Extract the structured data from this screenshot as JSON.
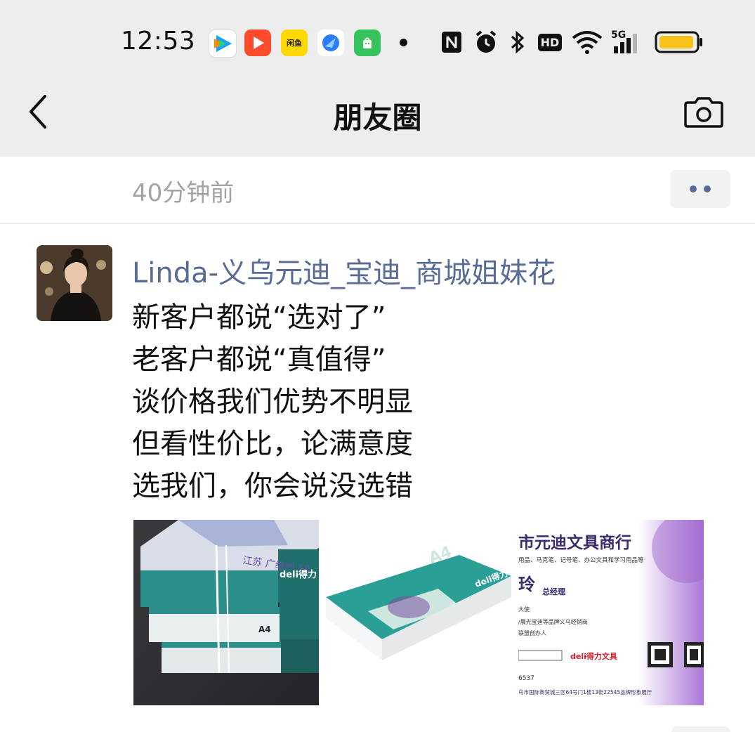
{
  "status_bar": {
    "time": "12:53",
    "app_icons": [
      {
        "name": "tencent-video-icon",
        "color": "#ffffff",
        "accent": "#1aa0ff"
      },
      {
        "name": "video-player-icon",
        "color": "#ff4b2b"
      },
      {
        "name": "xianyu-icon",
        "color": "#ffd900",
        "label": "闲鱼"
      },
      {
        "name": "browser-icon",
        "color": "#ffffff",
        "accent": "#2b7cff"
      },
      {
        "name": "shopping-icon",
        "color": "#37c35b"
      }
    ],
    "system_icons": [
      "nfc-icon",
      "alarm-icon",
      "bluetooth-icon",
      "hd-icon",
      "wifi-icon",
      "signal-5g-icon",
      "battery-icon"
    ],
    "hd_label": "HD",
    "network_label": "5G",
    "battery_color": "#f7c21b"
  },
  "nav": {
    "title": "朋友圈",
    "back_icon": "chevron-left-icon",
    "camera_icon": "camera-icon"
  },
  "previous_post": {
    "time_ago": "40分钟前"
  },
  "post": {
    "author": "Linda-义乌元迪_宝迪_商城姐妹花",
    "lines": [
      "新客户都说“选对了”",
      "老客户都说“真值得”",
      "谈价格我们优势不明显",
      "但看性价比，论满意度",
      "选我们，你会说没选错"
    ],
    "images": [
      {
        "name": "photo-paper-boxes",
        "texts": {
          "box_brand": "deli得力",
          "box_size": "A4",
          "handwriting": "江苏 广维州 10"
        }
      },
      {
        "name": "photo-paper-ream",
        "texts": {
          "brand": "deli得力",
          "size": "A4"
        }
      },
      {
        "name": "photo-business-card",
        "texts": {
          "company": "市元迪文具商行",
          "products": "用品、马克笔、记号笔、办公文具和学习用品等",
          "person_name_partial": "玲",
          "title": "总经理",
          "line1": "大使",
          "line2": "/晨光宝迪等品牌义乌经销商",
          "line3": "联盟创办人",
          "deli_brand": "deli得力文具",
          "phone_partial": "6537",
          "address": "乌市国际商贸城三区64号门1楼13街22545品牌形象展厅"
        }
      }
    ]
  },
  "colors": {
    "header_bg": "#ededed",
    "link_blue": "#576b95",
    "time_gray": "#a3a3a3",
    "text": "#111111"
  }
}
